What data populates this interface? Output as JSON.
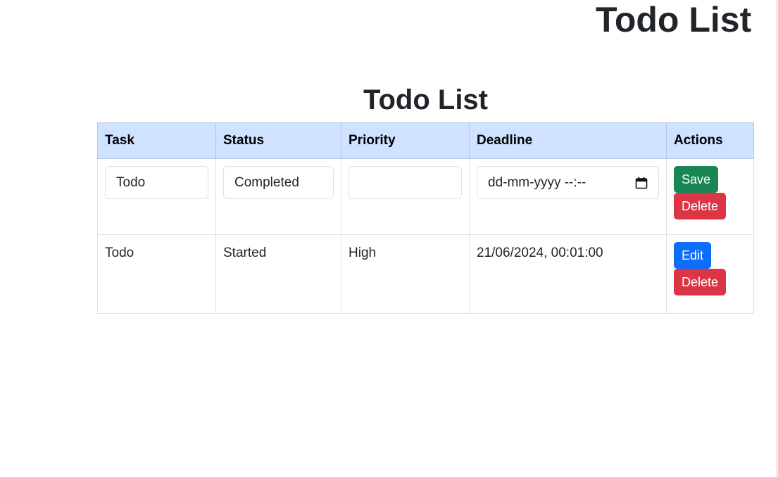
{
  "header": {
    "title": "Todo List"
  },
  "main": {
    "title": "Todo List",
    "columns": [
      "Task",
      "Status",
      "Priority",
      "Deadline",
      "Actions"
    ],
    "edit_row": {
      "task_value": "Todo",
      "status_value": "Completed",
      "priority_value": "",
      "deadline_placeholder": "dd-mm-yyyy --:--",
      "save_label": "Save",
      "delete_label": "Delete"
    },
    "rows": [
      {
        "task": "Todo",
        "status": "Started",
        "priority": "High",
        "deadline": "21/06/2024, 00:01:00",
        "edit_label": "Edit",
        "delete_label": "Delete"
      }
    ]
  },
  "colors": {
    "header_bg": "#cfe2ff",
    "save": "#198754",
    "edit": "#0d6efd",
    "delete": "#dc3545"
  },
  "icons": {
    "calendar": "calendar-icon"
  }
}
